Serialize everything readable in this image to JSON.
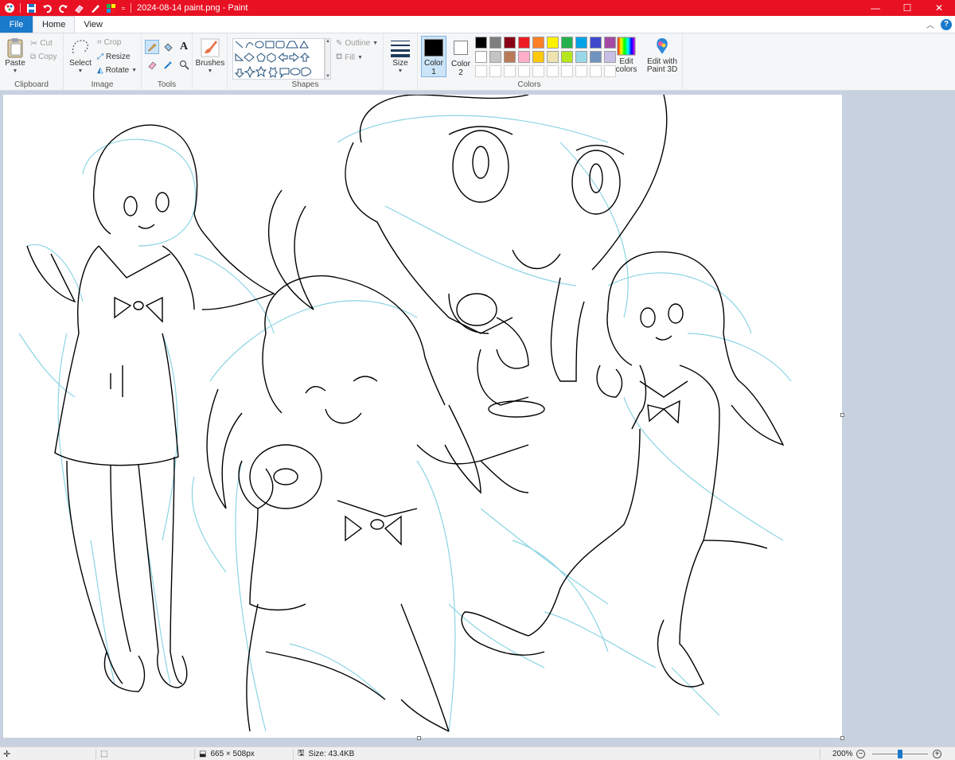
{
  "window": {
    "title": "2024-08-14 paint.png - Paint",
    "minimize": "—",
    "maximize": "☐",
    "close": "✕"
  },
  "menu": {
    "file": "File",
    "home": "Home",
    "view": "View"
  },
  "ribbon": {
    "clipboard": {
      "label": "Clipboard",
      "paste": "Paste",
      "cut": "Cut",
      "copy": "Copy"
    },
    "image": {
      "label": "Image",
      "select": "Select",
      "crop": "Crop",
      "resize": "Resize",
      "rotate": "Rotate"
    },
    "tools": {
      "label": "Tools"
    },
    "brushes": {
      "label": "Brushes"
    },
    "shapes": {
      "label": "Shapes",
      "outline": "Outline",
      "fill": "Fill"
    },
    "size": {
      "label": "Size"
    },
    "colors": {
      "label": "Colors",
      "color1": "Color\n1",
      "color1_a": "Color",
      "color1_b": "1",
      "color2_a": "Color",
      "color2_b": "2",
      "edit_colors_a": "Edit",
      "edit_colors_b": "colors",
      "paint3d_a": "Edit with",
      "paint3d_b": "Paint 3D",
      "palette_row1": [
        "#000000",
        "#7f7f7f",
        "#880015",
        "#ed1c24",
        "#ff7f27",
        "#fff200",
        "#22b14c",
        "#00a2e8",
        "#3f48cc",
        "#a349a4"
      ],
      "palette_row2": [
        "#ffffff",
        "#c3c3c3",
        "#b97a57",
        "#ffaec9",
        "#ffc90e",
        "#efe4b0",
        "#b5e61d",
        "#99d9ea",
        "#7092be",
        "#c8bfe7"
      ],
      "current_color1": "#000000",
      "current_color2": "#ffffff"
    }
  },
  "status": {
    "dimensions": "665 × 508px",
    "size": "Size: 43.4KB",
    "zoom": "200%",
    "zoom_fraction": 0.5
  }
}
